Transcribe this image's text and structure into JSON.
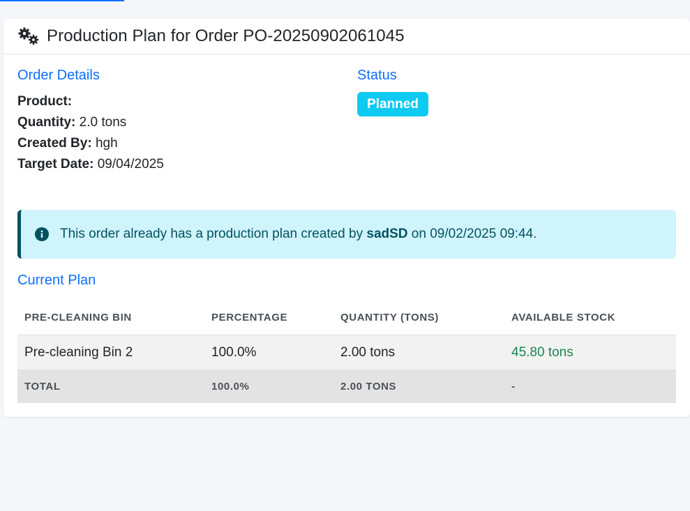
{
  "header": {
    "title": "Production Plan for Order PO-20250902061045"
  },
  "order_details": {
    "section_title": "Order Details",
    "product_label": "Product:",
    "product_value": "",
    "quantity_label": "Quantity:",
    "quantity_value": "2.0 tons",
    "created_by_label": "Created By:",
    "created_by_value": "hgh",
    "target_date_label": "Target Date:",
    "target_date_value": "09/04/2025"
  },
  "status": {
    "section_title": "Status",
    "badge": "Planned",
    "badge_color": "#0dcaf0"
  },
  "alert": {
    "text_before": "This order already has a production plan created by",
    "user": "sadSD",
    "text_after": "on 09/02/2025 09:44."
  },
  "current_plan": {
    "section_title": "Current Plan",
    "columns": [
      "PRE-CLEANING BIN",
      "PERCENTAGE",
      "QUANTITY (TONS)",
      "AVAILABLE STOCK"
    ],
    "rows": [
      {
        "bin": "Pre-cleaning Bin 2",
        "percentage": "100.0%",
        "quantity": "2.00 tons",
        "stock": "45.80 tons"
      }
    ],
    "total": {
      "label": "TOTAL",
      "percentage": "100.0%",
      "quantity": "2.00 TONS",
      "stock": "-"
    }
  },
  "colors": {
    "accent": "#0d6efd",
    "alert_bg": "#cff4fc",
    "alert_text": "#055160",
    "stock_green": "#198754"
  }
}
